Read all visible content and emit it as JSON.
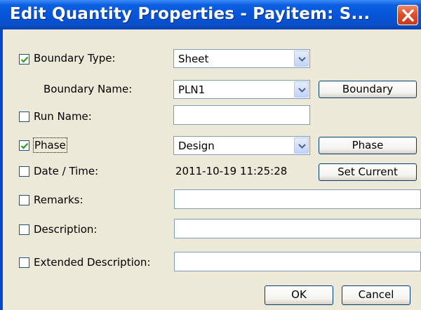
{
  "window": {
    "title": "Edit Quantity Properties - Payitem: S..."
  },
  "fields": {
    "boundary_type": {
      "label": "Boundary Type:",
      "checked": true,
      "value": "Sheet"
    },
    "boundary_name": {
      "label": "Boundary Name:",
      "value": "PLN1",
      "button": "Boundary"
    },
    "run_name": {
      "label": "Run Name:",
      "checked": false,
      "value": ""
    },
    "phase": {
      "label": "Phase",
      "checked": true,
      "value": "Design",
      "button": "Phase"
    },
    "date_time": {
      "label": "Date / Time:",
      "checked": false,
      "value": "2011-10-19 11:25:28",
      "button": "Set Current"
    },
    "remarks": {
      "label": "Remarks:",
      "checked": false,
      "value": ""
    },
    "description": {
      "label": "Description:",
      "checked": false,
      "value": ""
    },
    "extended_description": {
      "label": "Extended Description:",
      "checked": false,
      "value": ""
    }
  },
  "footer": {
    "ok_label": "OK",
    "cancel_label": "Cancel"
  },
  "icons": {
    "close": "close-icon",
    "checkbox_check": "check-icon",
    "dropdown": "chevron-down-icon"
  },
  "colors": {
    "title_bar": "#0754d8",
    "close_button": "#e0502c",
    "dialog_background": "#ece9d8"
  }
}
